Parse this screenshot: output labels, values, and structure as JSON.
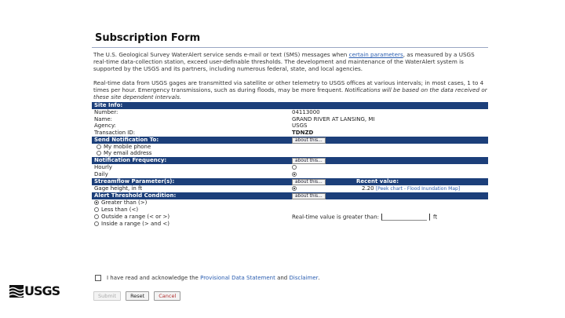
{
  "form": {
    "title": "Subscription Form",
    "intro_before_link": "The U.S. Geological Survey WaterAlert service sends e-mail or text (SMS) messages when ",
    "intro_link": "certain parameters",
    "intro_after_link": ", as measured by a USGS real-time data-collection station, exceed user-definable thresholds. The development and maintenance of the WaterAlert system is supported by the USGS and its partners, including numerous federal, state, and local agencies.",
    "realtime_text": "Real-time data from USGS gages are transmitted via satellite or other telemetry to USGS offices at various intervals; in most cases, 1 to 4 times per hour. Emergency transmissions, such as during floods, may be more frequent. ",
    "realtime_italic": "Notifications will be based on the data received or these site dependent intervals."
  },
  "site_info": {
    "header": "Site Info:",
    "rows": [
      {
        "label": "Number:",
        "value": "04113000"
      },
      {
        "label": "Name:",
        "value": "GRAND RIVER AT LANSING, MI"
      },
      {
        "label": "Agency:",
        "value": "USGS"
      },
      {
        "label": "Transaction ID:",
        "value": "TDNZD"
      }
    ]
  },
  "send_to": {
    "header": "Send Notification To:",
    "about": "about this...",
    "options": [
      "My mobile phone",
      "My email address"
    ]
  },
  "frequency": {
    "header": "Notification Frequency:",
    "about": "about this...",
    "options": [
      {
        "label": "Hourly",
        "selected": false
      },
      {
        "label": "Daily",
        "selected": true
      }
    ]
  },
  "parameters": {
    "header": "Streamflow Parameter(s):",
    "about": "about this...",
    "recent_label": "Recent value:",
    "param_label": "Gage height, in ft",
    "recent_value": "2.20",
    "links": "[Peek chart - Flood Inundation Map]"
  },
  "threshold": {
    "header": "Alert Threshold Condition:",
    "about": "about this...",
    "options": [
      {
        "label": "Greater than (>)",
        "selected": true
      },
      {
        "label": "Less than (<)",
        "selected": false
      },
      {
        "label": "Outside a range (< or >)",
        "selected": false
      },
      {
        "label": "Inside a range (> and <)",
        "selected": false
      }
    ],
    "value_label": "Real-time value is greater than:",
    "unit": "ft"
  },
  "ack": {
    "text_before": "I have read and acknowledge the ",
    "link1": "Provisional Data Statement",
    "and": " and ",
    "link2": "Disclaimer",
    "end": "."
  },
  "buttons": {
    "submit": "Submit",
    "reset": "Reset",
    "cancel": "Cancel"
  },
  "logo": {
    "text": "USGS",
    "icon": "usgs-wave-icon"
  }
}
